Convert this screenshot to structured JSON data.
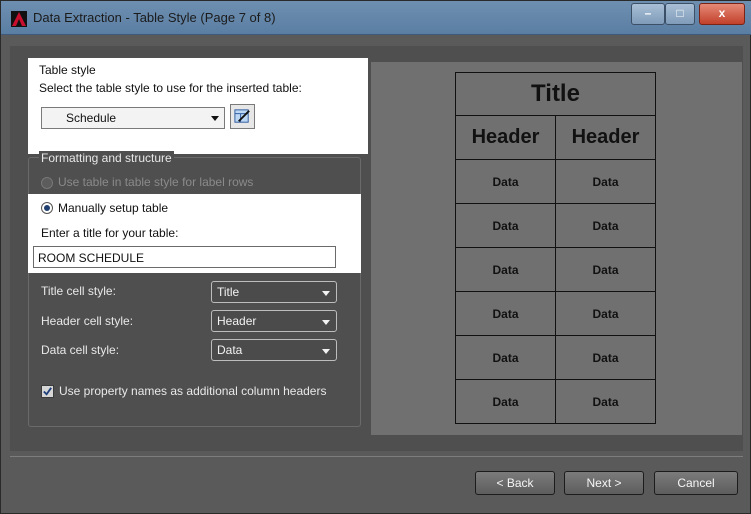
{
  "window": {
    "title": "Data Extraction - Table Style (Page 7 of 8)",
    "controls": {
      "minimize": "–",
      "maximize": "□",
      "close": "x"
    }
  },
  "table_style": {
    "group_label": "Table style",
    "instruction": "Select the table style to use for the inserted table:",
    "selected": "Schedule",
    "edit_icon": "table-style-edit-icon"
  },
  "formatting": {
    "group_label": "Formatting and structure",
    "use_table_style_label": "Use table in table style for label rows",
    "manual_label": "Manually setup table",
    "title_prompt": "Enter a title for your table:",
    "title_value": "ROOM SCHEDULE",
    "title_cell_label": "Title cell style:",
    "title_cell_value": "Title",
    "header_cell_label": "Header cell style:",
    "header_cell_value": "Header",
    "data_cell_label": "Data cell style:",
    "data_cell_value": "Data",
    "use_property_names_label": "Use property names as additional column headers"
  },
  "preview": {
    "title": "Title",
    "headers": [
      "Header",
      "Header"
    ],
    "rows": [
      [
        "Data",
        "Data"
      ],
      [
        "Data",
        "Data"
      ],
      [
        "Data",
        "Data"
      ],
      [
        "Data",
        "Data"
      ],
      [
        "Data",
        "Data"
      ],
      [
        "Data",
        "Data"
      ]
    ]
  },
  "buttons": {
    "back": "< Back",
    "next": "Next >",
    "cancel": "Cancel"
  },
  "colors": {
    "highlight": "#ffffff",
    "dialog_bg": "#4f4f4f",
    "titlebar": "#6e8fb0",
    "app_icon_red": "#c8102e"
  }
}
